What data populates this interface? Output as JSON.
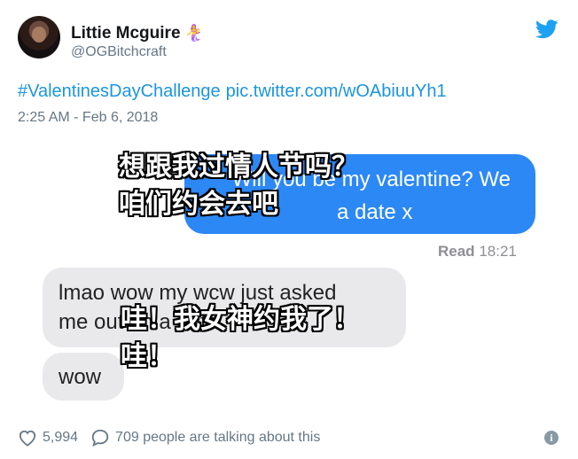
{
  "user": {
    "display_name": "Littie Mcguire",
    "name_emoji": "🧜‍♀️",
    "handle": "@OGBitchcraft"
  },
  "tweet": {
    "hashtag": "#ValentinesDayChallenge",
    "link": "pic.twitter.com/wOAbiuuYh1",
    "timestamp": "2:25 AM - Feb 6, 2018"
  },
  "chat": {
    "sent_line1": "Will you be my valentine? We",
    "sent_line2": "a date x",
    "read_label": "Read",
    "read_time": "18:21",
    "received1_line1": "lmao wow my wcw just asked",
    "received1_line2": "me out on a date",
    "received2": "wow"
  },
  "subtitles": {
    "sub1": "想跟我过情人节吗？",
    "sub2": "咱们约会去吧",
    "sub3": "哇！我女神约我了！",
    "sub4": "哇！"
  },
  "footer": {
    "likes": "5,994",
    "talking": "709 people are talking about this",
    "info_icon": "info-icon"
  },
  "colors": {
    "link": "#1b95e0",
    "bubble_sent": "#2c88f5",
    "bubble_received": "#e9e9ec",
    "muted": "#657786"
  }
}
